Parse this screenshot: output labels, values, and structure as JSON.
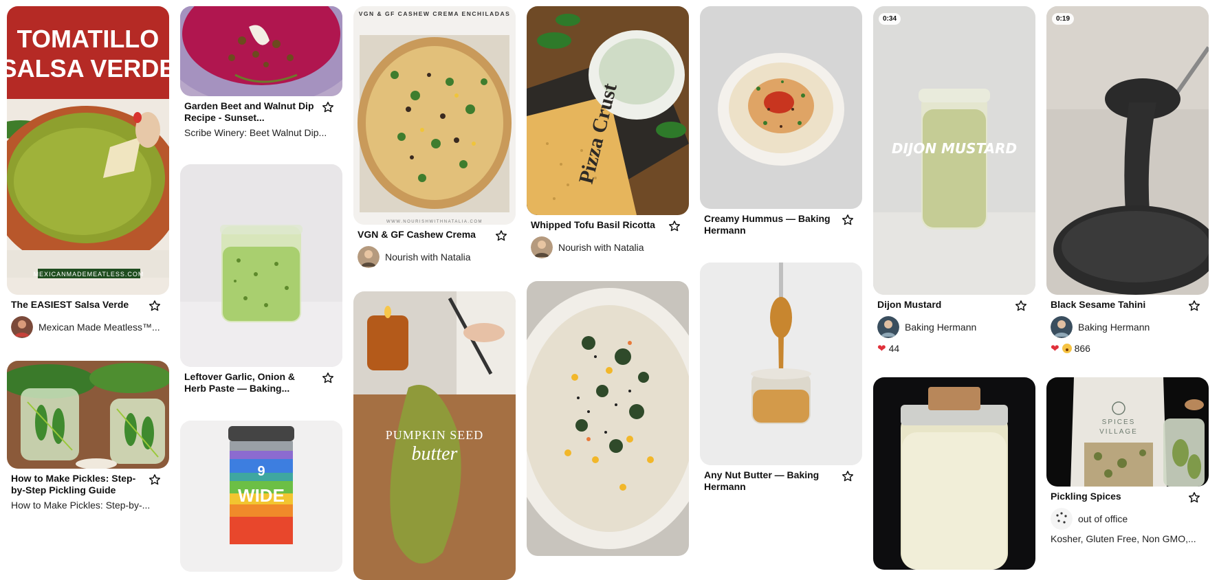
{
  "pins": [
    {
      "id": "salsa-verde",
      "title": "The EASIEST Salsa Verde",
      "author": "Mexican Made Meatless™...",
      "image_text": {
        "line1": "TOMATILLO",
        "line2": "SALSA VERDE",
        "footer": "MEXICANMADEMEATLESS.COM"
      }
    },
    {
      "id": "pickles",
      "title": "How to Make Pickles: Step-by-Step Pickling Guide",
      "subtitle": "How to Make Pickles: Step-by-..."
    },
    {
      "id": "beet-dip",
      "title": "Garden Beet and Walnut Dip Recipe - Sunset...",
      "subtitle": "Scribe Winery: Beet Walnut Dip..."
    },
    {
      "id": "garlic-paste",
      "title": "Leftover Garlic, Onion & Herb Paste — Baking..."
    },
    {
      "id": "spice-jars",
      "image_text": {
        "num": "9",
        "word": "WIDE"
      }
    },
    {
      "id": "enchiladas",
      "title": "VGN & GF Cashew Crema",
      "author": "Nourish with Natalia",
      "image_text": {
        "header": "VGN & GF CASHEW CREMA ENCHILADAS",
        "footer": "WWW.NOURISHWITHNATALIA.COM"
      }
    },
    {
      "id": "pumpkin-butter",
      "image_text": {
        "line1": "PUMPKIN SEED",
        "line2": "butter"
      }
    },
    {
      "id": "tofu-ricotta",
      "title": "Whipped Tofu Basil Ricotta",
      "author": "Nourish with Natalia",
      "image_text": {
        "board": "Pizza Crust"
      }
    },
    {
      "id": "rice-bowl"
    },
    {
      "id": "hummus",
      "title": "Creamy Hummus — Baking Hermann"
    },
    {
      "id": "nut-butter",
      "title": "Any Nut Butter — Baking Hermann"
    },
    {
      "id": "dijon",
      "title": "Dijon Mustard",
      "author": "Baking Hermann",
      "count": "44",
      "duration": "0:34",
      "image_text": {
        "overlay": "DIJON MUSTARD"
      }
    },
    {
      "id": "milk-jar"
    },
    {
      "id": "tahini",
      "title": "Black Sesame Tahini",
      "author": "Baking Hermann",
      "count": "866",
      "duration": "0:19"
    },
    {
      "id": "pickling-spices",
      "title": "Pickling Spices",
      "author": "out of office",
      "subtitle": "Kosher, Gluten Free, Non GMO,...",
      "image_text": {
        "brand1": "SPICES",
        "brand2": "VILLAGE"
      }
    }
  ],
  "icons": {
    "save": "star-outline-icon",
    "heart": "heart-reaction-icon",
    "wow": "wow-reaction-icon"
  },
  "colors": {
    "accent_red": "#b52a25",
    "heart": "#e0303a"
  }
}
